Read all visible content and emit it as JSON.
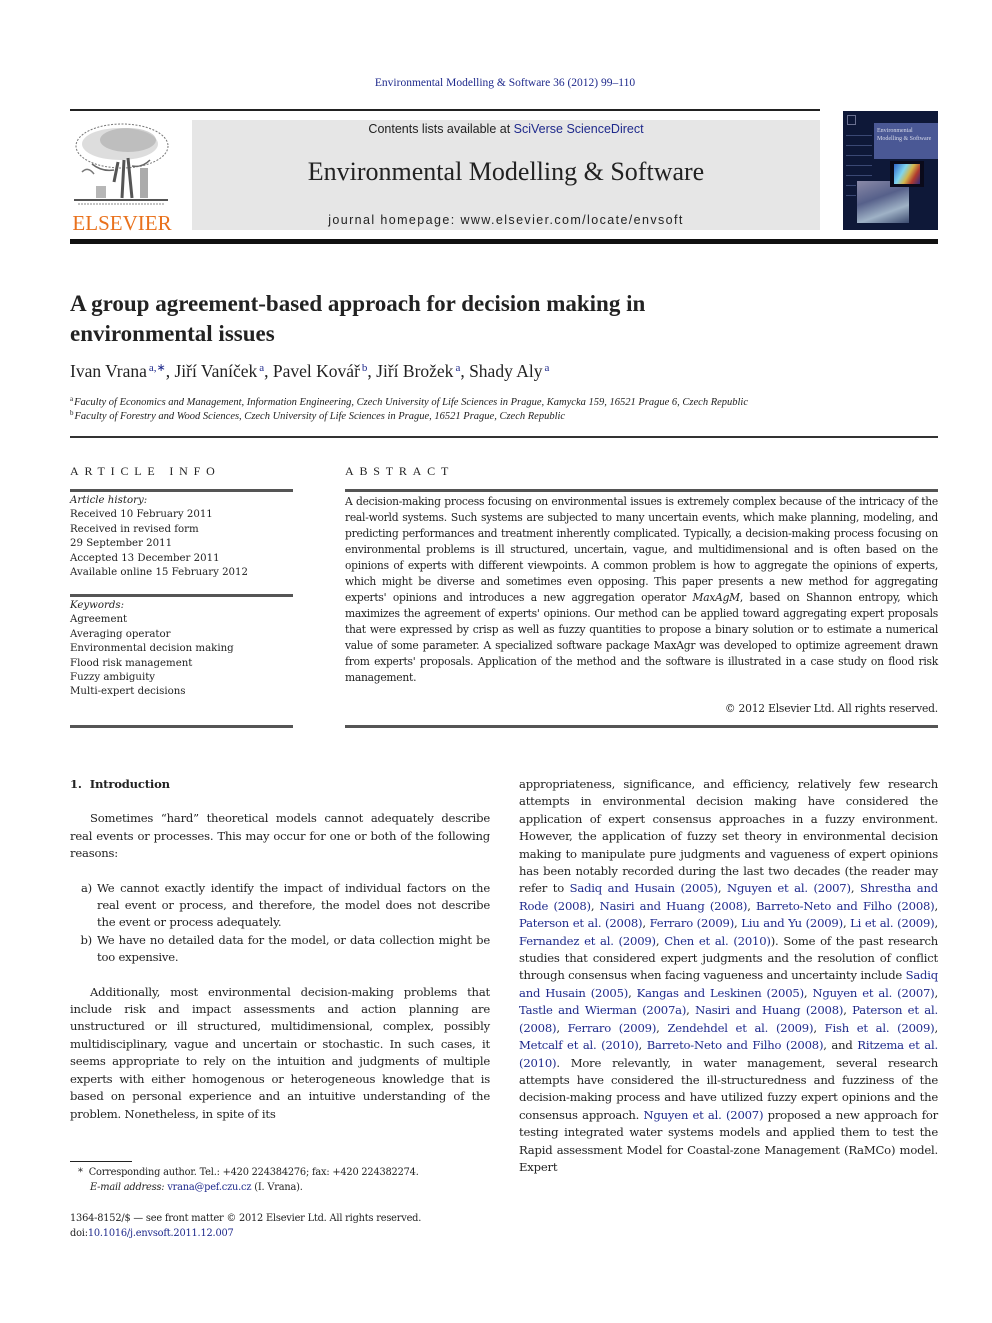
{
  "header": {
    "journal_reference": "Environmental Modelling & Software 36 (2012) 99–110",
    "contents_prefix": "Contents lists available at ",
    "contents_link": "SciVerse ScienceDirect",
    "journal_title": "Environmental Modelling & Software",
    "homepage": "journal homepage: www.elsevier.com/locate/envsoft",
    "publisher_wordmark": "ELSEVIER",
    "cover_title": "Environmental Modelling & Software",
    "colors": {
      "link": "#1f2a8c",
      "elsevier_orange": "#e9711c",
      "banner_bg": "#e6e6e6",
      "cover_bg": "#0e1838"
    }
  },
  "article": {
    "title": "A group agreement-based approach for decision making in environmental issues",
    "authors": [
      {
        "name": "Ivan Vrana",
        "sup": "a,∗"
      },
      {
        "name": "Jiří Vaníček",
        "sup": "a"
      },
      {
        "name": "Pavel Kovář",
        "sup": "b"
      },
      {
        "name": "Jiří Brožek",
        "sup": "a"
      },
      {
        "name": "Shady Aly",
        "sup": "a"
      }
    ],
    "affiliations": [
      {
        "label": "a",
        "text": "Faculty of Economics and Management, Information Engineering, Czech University of Life Sciences in Prague, Kamycka 159, 16521 Prague 6, Czech Republic"
      },
      {
        "label": "b",
        "text": "Faculty of Forestry and Wood Sciences, Czech University of Life Sciences in Prague, 16521 Prague, Czech Republic"
      }
    ]
  },
  "article_info": {
    "heading": "ARTICLE INFO",
    "history_label": "Article history:",
    "history": [
      "Received 10 February 2011",
      "Received in revised form",
      "29 September 2011",
      "Accepted 13 December 2011",
      "Available online 15 February 2012"
    ],
    "keywords_label": "Keywords:",
    "keywords": [
      "Agreement",
      "Averaging operator",
      "Environmental decision making",
      "Flood risk management",
      "Fuzzy ambiguity",
      "Multi-expert decisions"
    ]
  },
  "abstract": {
    "heading": "ABSTRACT",
    "part1": "A decision-making process focusing on environmental issues is extremely complex because of the intricacy of the real-world systems. Such systems are subjected to many uncertain events, which make planning, modeling, and predicting performances and treatment inherently complicated. Typically, a decision-making process focusing on environmental problems is ill structured, uncertain, vague, and multidimensional and is often based on the opinions of experts with different viewpoints. A common problem is how to aggregate the opinions of experts, which might be diverse and sometimes even opposing. This paper presents a new method for aggregating experts' opinions and introduces a new aggregation operator ",
    "operator": "MaxAgM",
    "part2": ", based on Shannon entropy, which maximizes the agreement of experts' opinions. Our method can be applied toward aggregating expert proposals that were expressed by crisp as well as fuzzy quantities to propose a binary solution or to estimate a numerical value of some parameter. A specialized software package MaxAgr was developed to optimize agreement drawn from experts' proposals. Application of the method and the software is illustrated in a case study on flood risk management.",
    "copyright": "© 2012 Elsevier Ltd. All rights reserved."
  },
  "body": {
    "section_number": "1.",
    "section_title": "Introduction",
    "para1": "Sometimes “hard” theoretical models cannot adequately describe real events or processes. This may occur for one or both of the following reasons:",
    "list": [
      {
        "marker": "a)",
        "text": "We cannot exactly identify the impact of individual factors on the real event or process, and therefore, the model does not describe the event or process adequately."
      },
      {
        "marker": "b)",
        "text": "We have no detailed data for the model, or data collection might be too expensive."
      }
    ],
    "para2": "Additionally, most environmental decision-making problems that include risk and impact assessments and action planning are unstructured or ill structured, multidimensional, complex, possibly multidisciplinary, vague and uncertain or stochastic. In such cases, it seems appropriate to rely on the intuition and judgments of multiple experts with either homogenous or heterogeneous knowledge that is based on personal experience and an intuitive understanding of the problem. Nonetheless, in spite of its",
    "right_column": [
      {
        "t": "text",
        "v": "appropriateness, significance, and efficiency, relatively few research attempts in environmental decision making have considered the application of expert consensus approaches in a fuzzy environment. However, the application of fuzzy set theory in environmental decision making to manipulate pure judgments and vagueness of expert opinions has been notably recorded during the last two decades (the reader may refer to "
      },
      {
        "t": "link",
        "v": "Sadiq and Husain (2005)"
      },
      {
        "t": "text",
        "v": ", "
      },
      {
        "t": "link",
        "v": "Nguyen et al. (2007)"
      },
      {
        "t": "text",
        "v": ", "
      },
      {
        "t": "link",
        "v": "Shrestha and Rode (2008)"
      },
      {
        "t": "text",
        "v": ", "
      },
      {
        "t": "link",
        "v": "Nasiri and Huang (2008)"
      },
      {
        "t": "text",
        "v": ", "
      },
      {
        "t": "link",
        "v": "Barreto-Neto and Filho (2008)"
      },
      {
        "t": "text",
        "v": ", "
      },
      {
        "t": "link",
        "v": "Paterson et al. (2008)"
      },
      {
        "t": "text",
        "v": ", "
      },
      {
        "t": "link",
        "v": "Ferraro (2009)"
      },
      {
        "t": "text",
        "v": ", "
      },
      {
        "t": "link",
        "v": "Liu and Yu (2009)"
      },
      {
        "t": "text",
        "v": ", "
      },
      {
        "t": "link",
        "v": "Li et al. (2009)"
      },
      {
        "t": "text",
        "v": ", "
      },
      {
        "t": "link",
        "v": "Fernandez et al. (2009)"
      },
      {
        "t": "text",
        "v": ", "
      },
      {
        "t": "link",
        "v": "Chen et al. (2010)"
      },
      {
        "t": "text",
        "v": "). Some of the past research studies that considered expert judgments and the resolution of conflict through consensus when facing vagueness and uncertainty include "
      },
      {
        "t": "link",
        "v": "Sadiq and Husain (2005)"
      },
      {
        "t": "text",
        "v": ", "
      },
      {
        "t": "link",
        "v": "Kangas and Leskinen (2005)"
      },
      {
        "t": "text",
        "v": ", "
      },
      {
        "t": "link",
        "v": "Nguyen et al. (2007)"
      },
      {
        "t": "text",
        "v": ", "
      },
      {
        "t": "link",
        "v": "Tastle and Wierman (2007a)"
      },
      {
        "t": "text",
        "v": ", "
      },
      {
        "t": "link",
        "v": "Nasiri and Huang (2008)"
      },
      {
        "t": "text",
        "v": ", "
      },
      {
        "t": "link",
        "v": "Paterson et al. (2008)"
      },
      {
        "t": "text",
        "v": ", "
      },
      {
        "t": "link",
        "v": "Ferraro (2009)"
      },
      {
        "t": "text",
        "v": ", "
      },
      {
        "t": "link",
        "v": "Zendehdel et al. (2009)"
      },
      {
        "t": "text",
        "v": ", "
      },
      {
        "t": "link",
        "v": "Fish et al. (2009)"
      },
      {
        "t": "text",
        "v": ", "
      },
      {
        "t": "link",
        "v": "Metcalf et al. (2010)"
      },
      {
        "t": "text",
        "v": ", "
      },
      {
        "t": "link",
        "v": "Barreto-Neto and Filho (2008)"
      },
      {
        "t": "text",
        "v": ", and "
      },
      {
        "t": "link",
        "v": "Ritzema et al. (2010)"
      },
      {
        "t": "text",
        "v": ". More relevantly, in water management, several research attempts have considered the ill-structuredness and fuzziness of the decision-making process and have utilized fuzzy expert opinions and the consensus approach. "
      },
      {
        "t": "link",
        "v": "Nguyen et al. (2007)"
      },
      {
        "t": "text",
        "v": " proposed a new approach for testing integrated water systems models and applied them to test the Rapid assessment Model for Coastal-zone Management (RaMCo) model. Expert"
      }
    ]
  },
  "footnotes": {
    "corresponding_star": "*",
    "corresponding": "Corresponding author. Tel.: +420 224384276; fax: +420 224382274.",
    "email_label": "E-mail address:",
    "email": "vrana@pef.czu.cz",
    "email_suffix": " (I. Vrana).",
    "issn": "1364-8152/$ — see front matter © 2012 Elsevier Ltd. All rights reserved.",
    "doi_label": "doi:",
    "doi": "10.1016/j.envsoft.2011.12.007"
  }
}
